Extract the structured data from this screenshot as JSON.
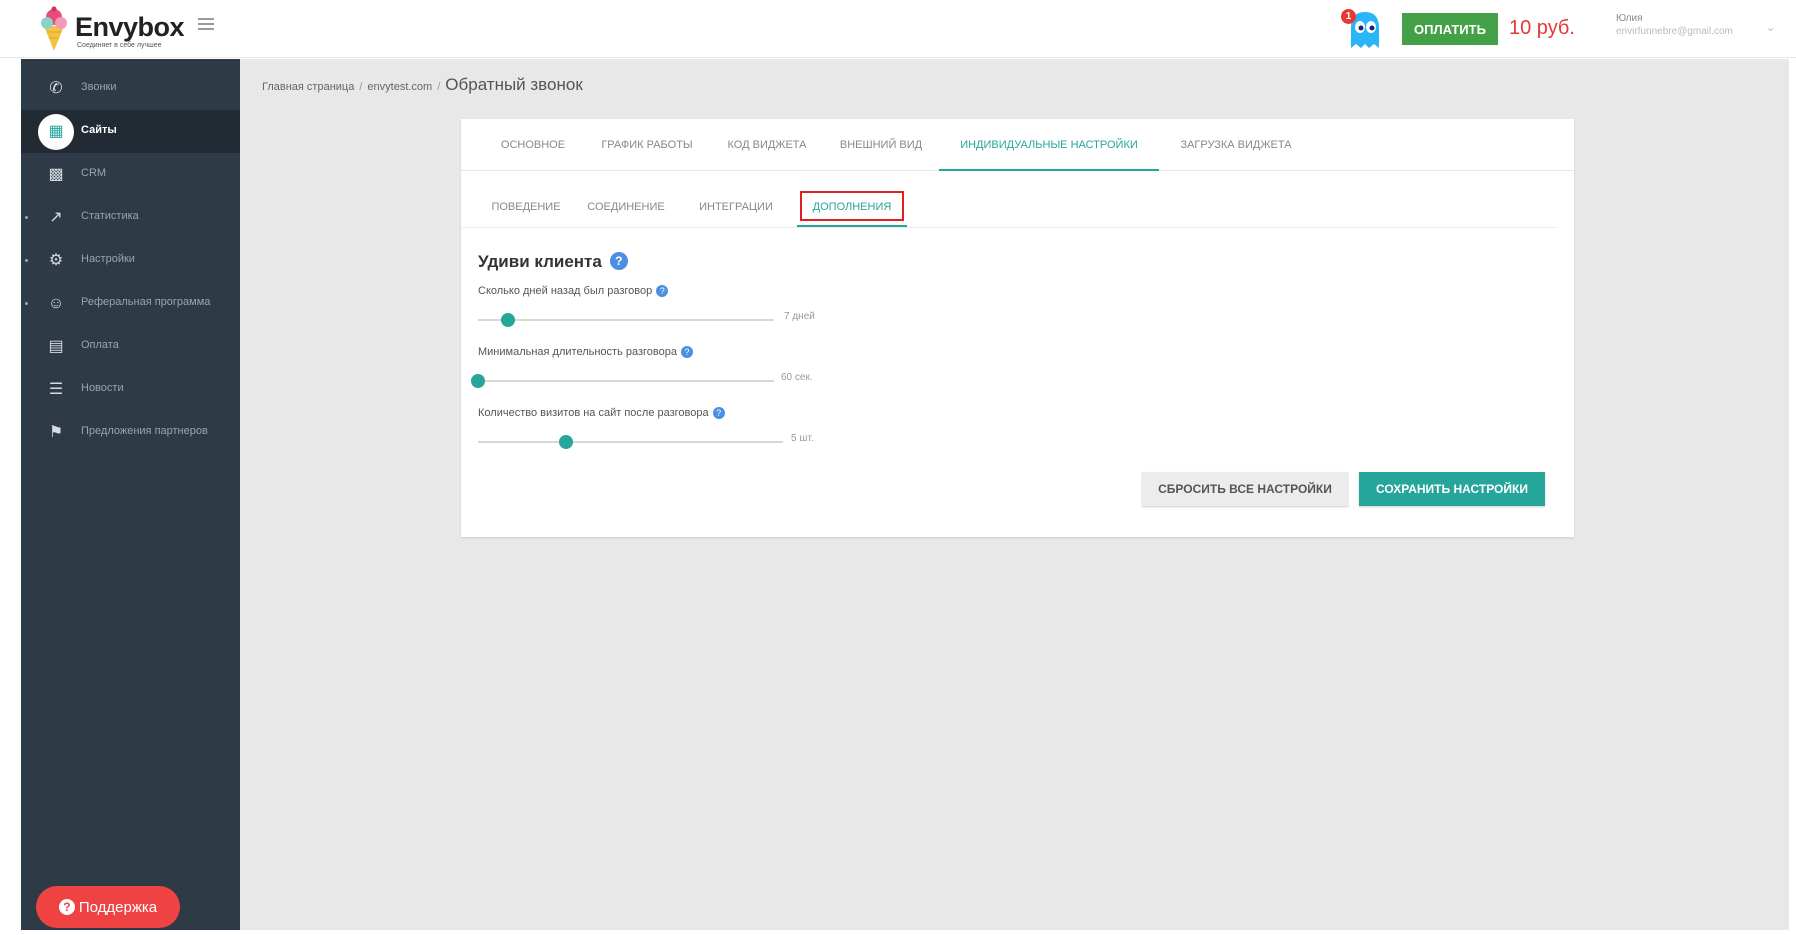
{
  "brand": {
    "name": "Envybox",
    "tagline": "Соединяет в себе лучшее"
  },
  "header": {
    "notification_count": "1",
    "pay_label": "ОПЛАТИТЬ",
    "balance": "10 руб.",
    "user_name": "Юлия",
    "user_email": "envirfunnebre@gmail.com"
  },
  "sidebar": {
    "items": [
      {
        "label": "Звонки",
        "icon": "phone-icon"
      },
      {
        "label": "Сайты",
        "icon": "grid-icon",
        "active": true
      },
      {
        "label": "CRM",
        "icon": "sitemap-icon"
      },
      {
        "label": "Статистика",
        "icon": "trending-up-icon"
      },
      {
        "label": "Настройки",
        "icon": "gear-icon"
      },
      {
        "label": "Реферальная программа",
        "icon": "people-icon"
      },
      {
        "label": "Оплата",
        "icon": "credit-card-icon"
      },
      {
        "label": "Новости",
        "icon": "list-icon"
      },
      {
        "label": "Предложения партнеров",
        "icon": "tag-icon"
      }
    ],
    "support_label": "Поддержка"
  },
  "breadcrumb": {
    "home": "Главная страница",
    "site": "envytest.com",
    "current": "Обратный звонок"
  },
  "tabs": [
    "ОСНОВНОЕ",
    "ГРАФИК РАБОТЫ",
    "КОД ВИДЖЕТА",
    "ВНЕШНИЙ ВИД",
    "ИНДИВИДУАЛЬНЫЕ НАСТРОЙКИ",
    "ЗАГРУЗКА ВИДЖЕТА"
  ],
  "active_tab": "ИНДИВИДУАЛЬНЫЕ НАСТРОЙКИ",
  "subtabs": [
    "ПОВЕДЕНИЕ",
    "СОЕДИНЕНИЕ",
    "ИНТЕГРАЦИИ",
    "ДОПОЛНЕНИЯ"
  ],
  "active_subtab": "ДОПОЛНЕНИЯ",
  "section": {
    "title": "Удиви клиента",
    "fields": [
      {
        "label": "Сколько дней назад был разговор",
        "value_text": "7 дней",
        "position": 0.1
      },
      {
        "label": "Минимальная длительность разговора",
        "value_text": "60 сек.",
        "position": 0.0
      },
      {
        "label": "Количество визитов на сайт после разговора",
        "value_text": "5 шт.",
        "position": 0.29
      }
    ]
  },
  "actions": {
    "reset_label": "СБРОСИТЬ ВСЕ НАСТРОЙКИ",
    "save_label": "СОХРАНИТЬ НАСТРОЙКИ"
  },
  "colors": {
    "accent": "#26a69a",
    "pay_button": "#43a047",
    "balance": "#e53935",
    "sidebar_bg": "#2e3a45",
    "support_button": "#ef4343",
    "highlight": "#e02020",
    "help_icon": "#4a90e2"
  }
}
